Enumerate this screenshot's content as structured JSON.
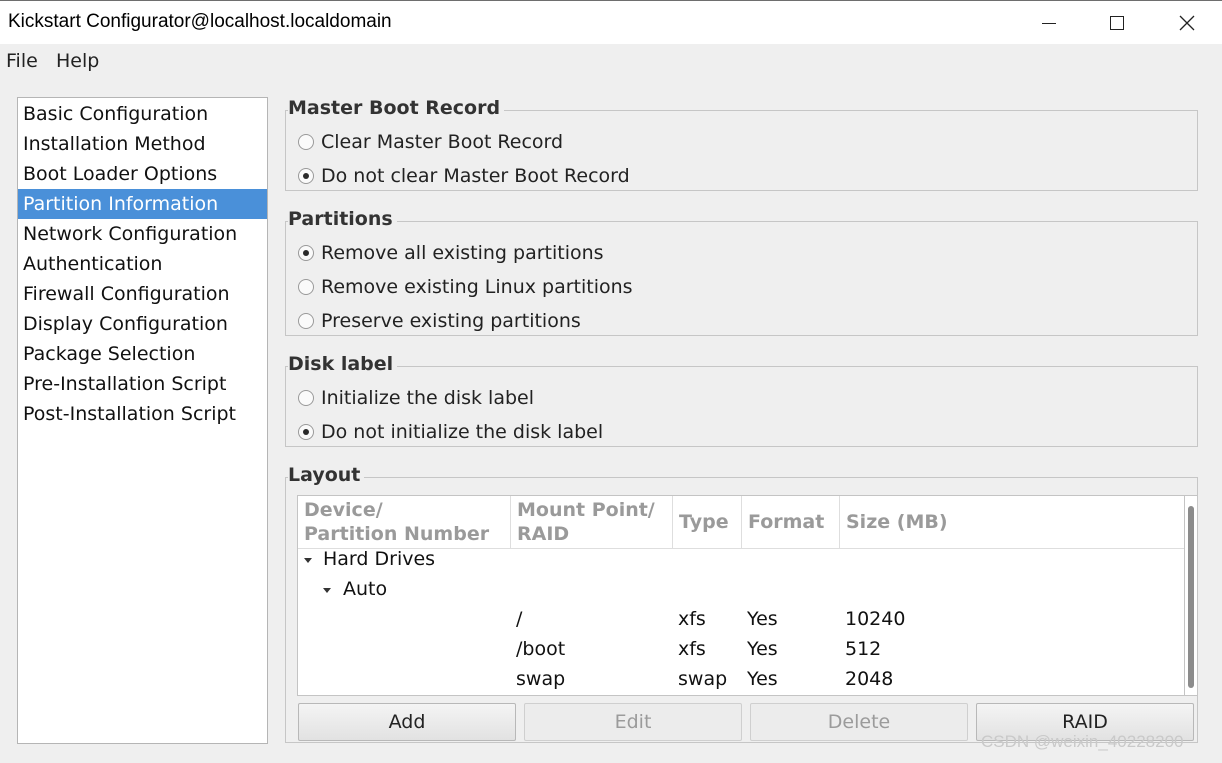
{
  "window": {
    "title": "Kickstart Configurator@localhost.localdomain",
    "controls": [
      "minimize-icon",
      "maximize-icon",
      "close-icon"
    ]
  },
  "menu": {
    "items": [
      "File",
      "Help"
    ]
  },
  "sidebar": {
    "selected": "Partition Information",
    "items": [
      "Basic Configuration",
      "Installation Method",
      "Boot Loader Options",
      "Partition Information",
      "Network Configuration",
      "Authentication",
      "Firewall Configuration",
      "Display Configuration",
      "Package Selection",
      "Pre-Installation Script",
      "Post-Installation Script"
    ]
  },
  "mbr": {
    "title": "Master Boot Record",
    "options": [
      {
        "label": "Clear Master Boot Record",
        "checked": false
      },
      {
        "label": "Do not clear Master Boot Record",
        "checked": true
      }
    ]
  },
  "partitions": {
    "title": "Partitions",
    "options": [
      {
        "label": "Remove all existing partitions",
        "checked": true
      },
      {
        "label": "Remove existing Linux partitions",
        "checked": false
      },
      {
        "label": "Preserve existing partitions",
        "checked": false
      }
    ]
  },
  "disk_label": {
    "title": "Disk label",
    "options": [
      {
        "label": "Initialize the disk label",
        "checked": false
      },
      {
        "label": "Do not initialize the disk label",
        "checked": true
      }
    ]
  },
  "layout": {
    "title": "Layout",
    "columns": [
      [
        "Device/",
        "Partition Number"
      ],
      [
        "Mount Point/",
        "RAID"
      ],
      [
        "Type"
      ],
      [
        "Format"
      ],
      [
        "Size (MB)"
      ]
    ],
    "tree": {
      "root": "Hard Drives",
      "child": "Auto",
      "rows": [
        {
          "mount": "/",
          "type": "xfs",
          "format": "Yes",
          "size": "10240"
        },
        {
          "mount": "/boot",
          "type": "xfs",
          "format": "Yes",
          "size": "512"
        },
        {
          "mount": "swap",
          "type": "swap",
          "format": "Yes",
          "size": "2048"
        }
      ]
    },
    "buttons": [
      {
        "label": "Add",
        "enabled": true
      },
      {
        "label": "Edit",
        "enabled": false
      },
      {
        "label": "Delete",
        "enabled": false
      },
      {
        "label": "RAID",
        "enabled": true
      }
    ]
  },
  "watermark": "CSDN @weixin_40228200",
  "colors": {
    "selection": "#4a90d9",
    "window_bg": "#efefef",
    "disabled_text": "#9b9b9b"
  }
}
